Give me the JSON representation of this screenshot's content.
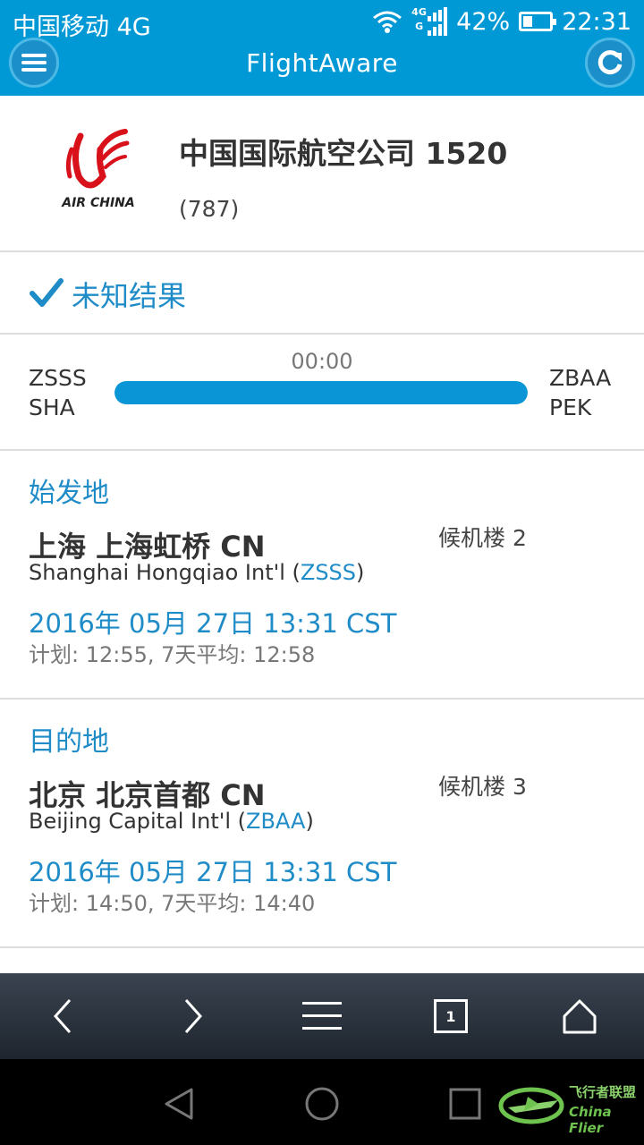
{
  "status_bar": {
    "carrier": "中国移动 4G",
    "signal_tag_top": "4G",
    "signal_tag_bottom": "G",
    "battery_percent_text": "42%",
    "battery_level": 0.42,
    "time": "22:31"
  },
  "app_bar": {
    "brand": "FlightAware",
    "menu_icon": "hamburger-menu",
    "refresh_icon": "refresh"
  },
  "flight": {
    "airline_logo_text": "AIR CHINA",
    "title": "中国国际航空公司 1520",
    "aircraft": "(787)"
  },
  "status": {
    "icon": "checkmark",
    "text": "未知结果"
  },
  "progress": {
    "elapsed": "00:00",
    "fraction": 1.0,
    "origin_icao": "ZSSS",
    "origin_iata": "SHA",
    "dest_icao": "ZBAA",
    "dest_iata": "PEK"
  },
  "origin": {
    "label": "始发地",
    "city": "上海 上海虹桥 CN",
    "terminal": "候机楼 2",
    "airport_name": "Shanghai Hongqiao Int'l (",
    "airport_code": "ZSSS",
    "airport_close": ")",
    "actual_time": "2016年 05月 27日 13:31 CST",
    "planned": "计划: 12:55, 7天平均: 12:58"
  },
  "destination": {
    "label": "目的地",
    "city": "北京 北京首都 CN",
    "terminal": "候机楼 3",
    "airport_name": "Beijing Capital Int'l (",
    "airport_code": "ZBAA",
    "airport_close": ")",
    "actual_time": "2016年 05月 27日 13:31 CST",
    "planned": "计划: 14:50, 7天平均: 14:40"
  },
  "browser_toolbar": {
    "tab_count": "1"
  },
  "watermark": {
    "cn": "飞行者联盟",
    "en": "China Flier"
  },
  "colors": {
    "brand_blue": "#0099d6",
    "link_blue": "#1f8cc8",
    "progress_fill": "#0a96d6"
  }
}
